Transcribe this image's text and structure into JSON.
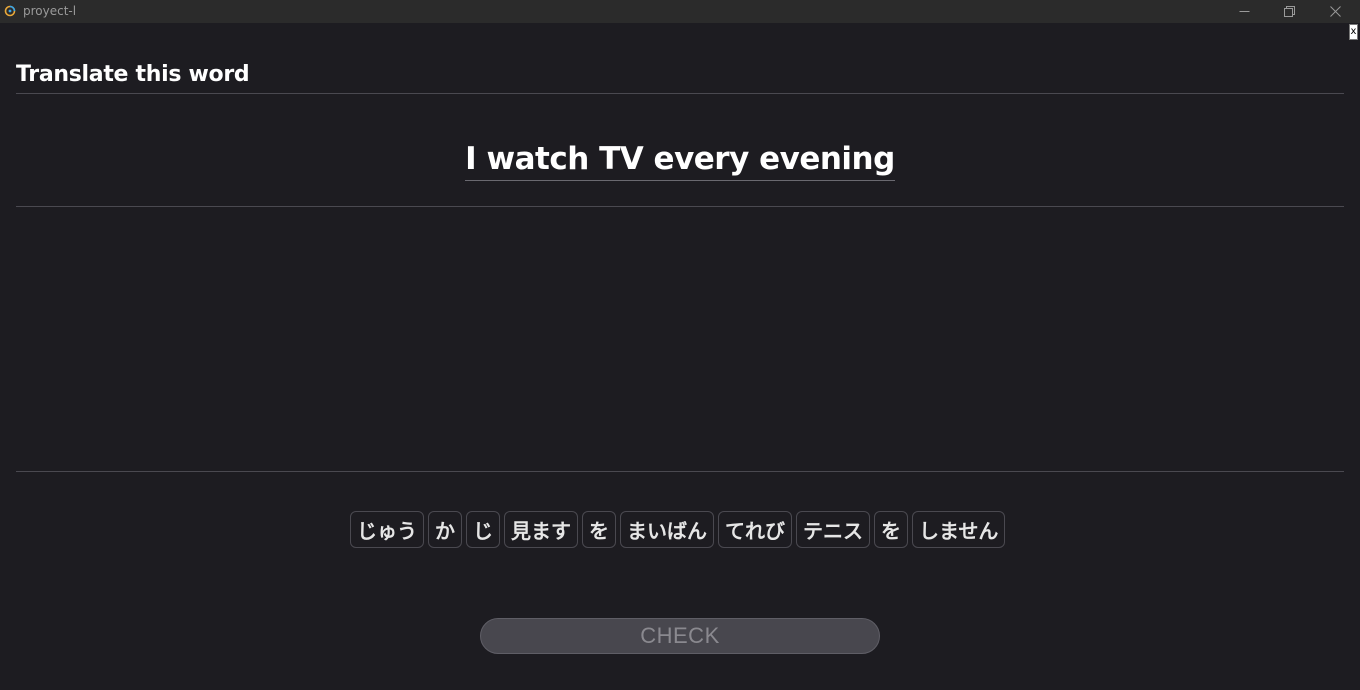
{
  "window": {
    "title": "proyect-l",
    "minimize_icon": "minimize-icon",
    "maximize_icon": "restore-icon",
    "close_icon": "close-icon"
  },
  "dialog_close_label": "x",
  "exercise": {
    "heading": "Translate this word",
    "prompt": "I watch TV every evening"
  },
  "word_bank": [
    "じゅう",
    "か",
    "じ",
    "見ます",
    "を",
    "まいばん",
    "てれび",
    "テニス",
    "を",
    "しません"
  ],
  "check_button": {
    "label": "CHECK"
  },
  "colors": {
    "background": "#1d1c21",
    "titlebar": "#2b2b2b",
    "text": "#ffffff",
    "divider": "#4a4950",
    "check_bg": "#48474e",
    "check_text": "#8a898f"
  }
}
